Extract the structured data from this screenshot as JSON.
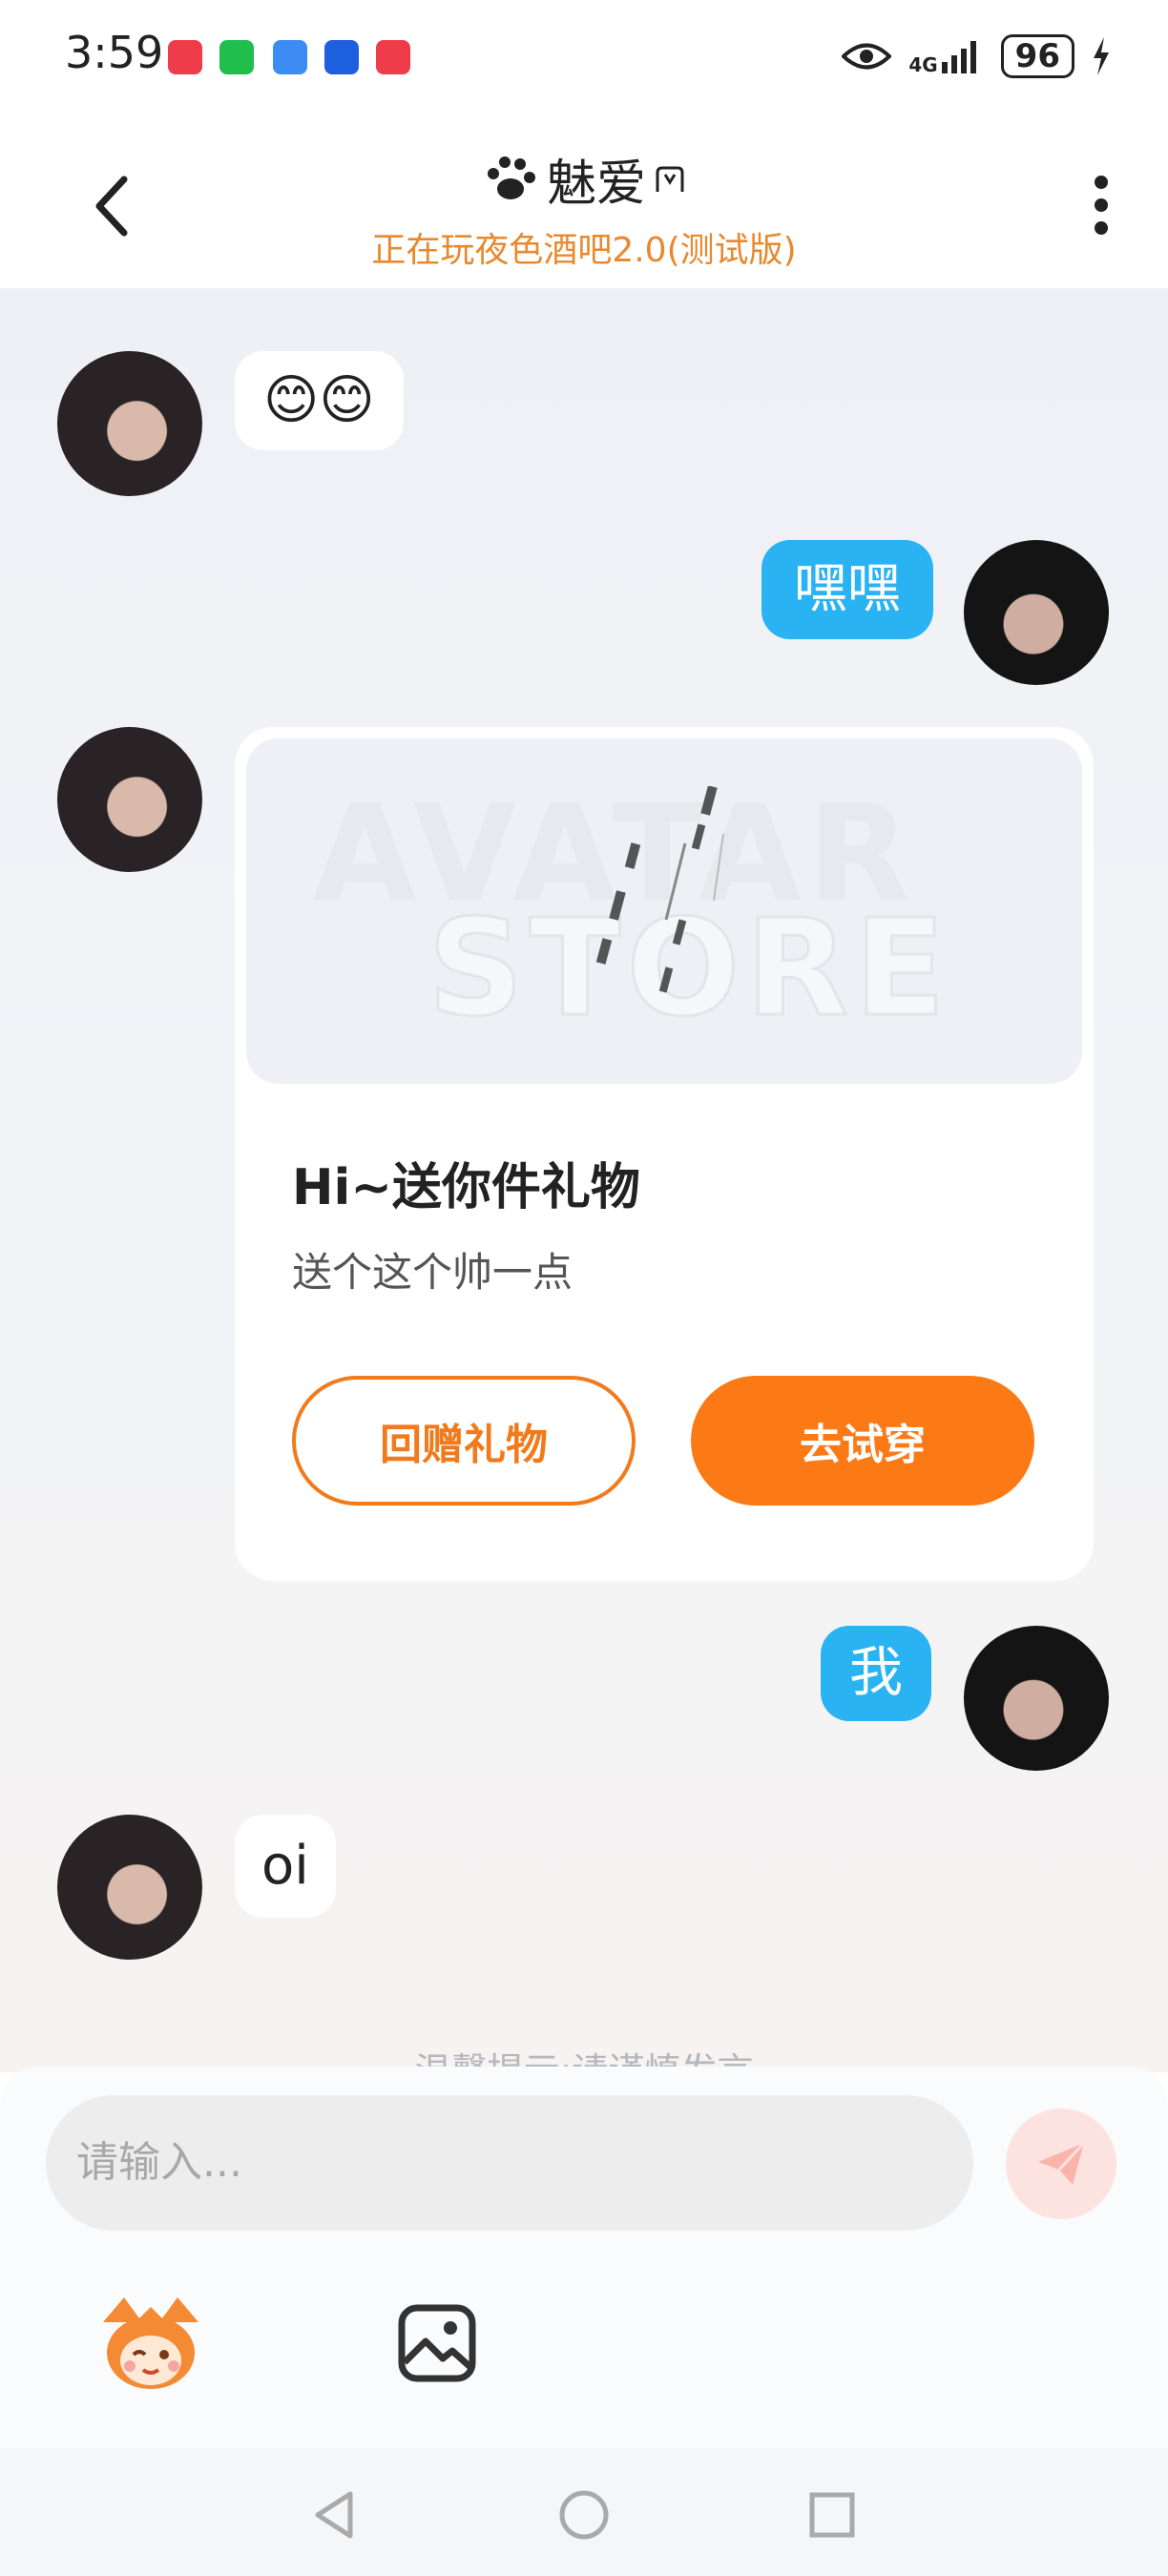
{
  "status_bar": {
    "time": "3:59",
    "network": "4G",
    "battery": "96"
  },
  "header": {
    "title": "魅爱",
    "subtitle": "正在玩夜色酒吧2.0(测试版)"
  },
  "messages": [
    {
      "side": "left",
      "text": "😊😊"
    },
    {
      "side": "right",
      "text": "嘿嘿"
    },
    {
      "side": "right",
      "text": "我"
    },
    {
      "side": "left",
      "text": "oi"
    }
  ],
  "gift_card": {
    "image_watermark_line1": "AVATAR",
    "image_watermark_line2": "STORE",
    "title": "Hi~送你件礼物",
    "description": "送个这个帅一点",
    "return_gift_label": "回赠礼物",
    "try_on_label": "去试穿"
  },
  "notice": "温馨提示:请谨慎发言",
  "composer": {
    "placeholder": "请输入..."
  },
  "colors": {
    "accent_orange": "#fb7a16",
    "bubble_blue": "#29b3f2",
    "subtitle_orange": "#e8892d"
  }
}
